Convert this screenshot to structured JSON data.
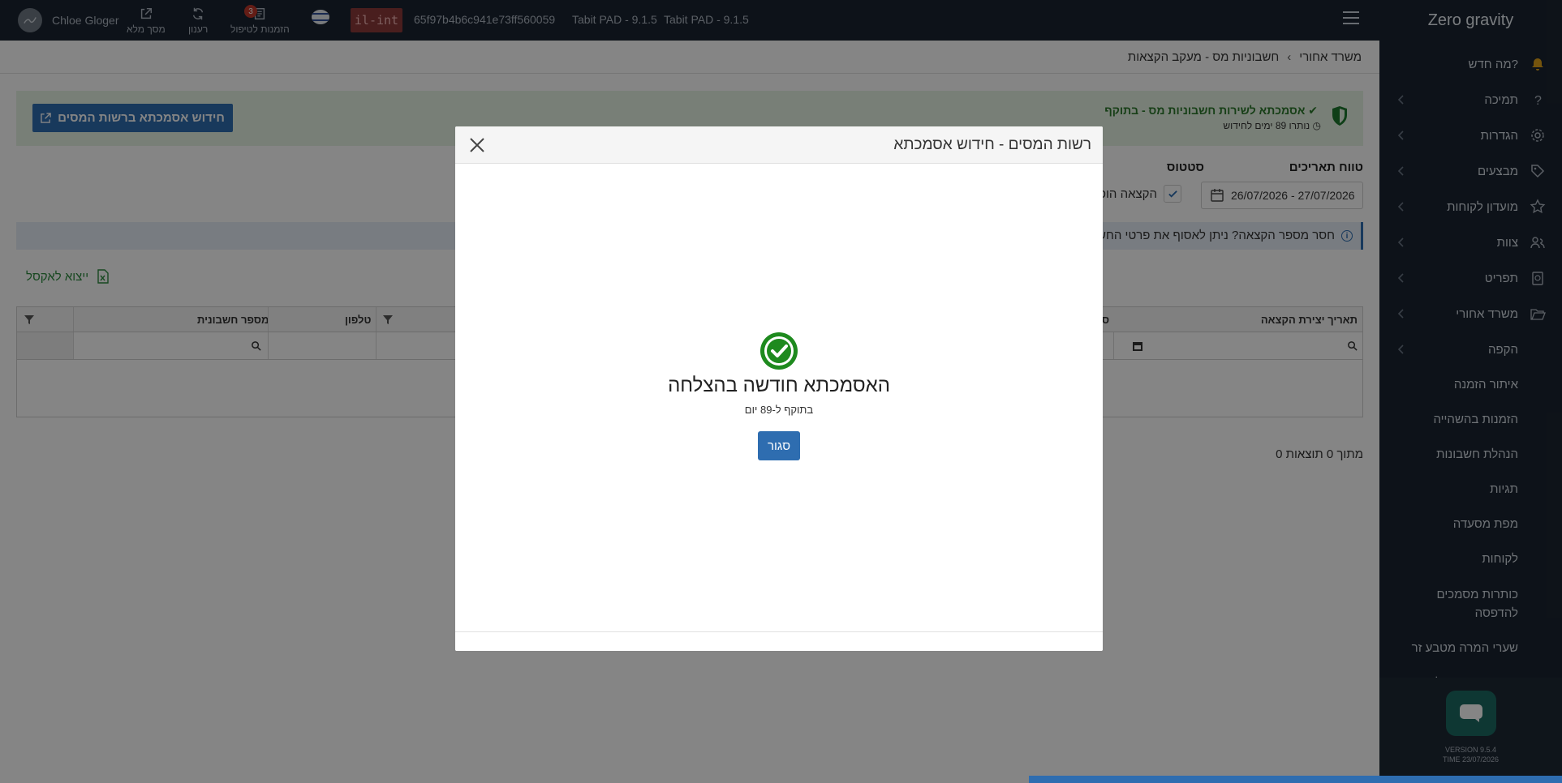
{
  "topbar": {
    "user_name": "Chloe Gloger",
    "fullscreen_label": "מסך מלא",
    "refresh_label": "רענון",
    "orders_label": "הזמנות לטיפול",
    "orders_count": "3",
    "env_badge": "il-int",
    "device_id": "65f97b4b6c941e73ff560059",
    "pad_version_1": "Tabit PAD - 9.1.5",
    "pad_version_2": "Tabit PAD - 9.1.5"
  },
  "sidebar": {
    "brand": "Zero gravity",
    "items": [
      {
        "label": "מה חדש?",
        "icon": "bell-icon"
      },
      {
        "label": "תמיכה",
        "icon": "question-icon"
      },
      {
        "label": "הגדרות",
        "icon": "gear-icon"
      },
      {
        "label": "מבצעים",
        "icon": "tag-icon"
      },
      {
        "label": "מועדון לקוחות",
        "icon": "star-icon"
      },
      {
        "label": "צוות",
        "icon": "team-icon"
      },
      {
        "label": "תפריט",
        "icon": "menu-book-icon"
      },
      {
        "label": "משרד אחורי",
        "icon": "folder-open-icon"
      },
      {
        "label": "הקפה",
        "icon": ""
      }
    ],
    "subitems": [
      "איתור הזמנה",
      "הזמנות בהשהייה",
      "הנהלת חשבונות",
      "תגיות",
      "מפת מסעדה",
      "לקוחות",
      "כותרות מסמכים להדפסה",
      "שערי המרה מטבע זר",
      "הגדרות תצוגת לקוח"
    ],
    "version": "VERSION 9.5.4",
    "time": "TIME 23/07/2026"
  },
  "breadcrumb": {
    "root": "משרד אחורי",
    "current": "חשבוניות מס - מעקב הקצאות"
  },
  "license": {
    "title": "אסמכתא לשירות חשבוניות מס - בתוקף",
    "remaining": "נותרו 89 ימים לחידוש",
    "renew_button": "חידוש אסמכתא ברשות המסים"
  },
  "filters": {
    "date_range_label": "טווח תאריכים",
    "date_range_value": "26/07/2026 - 27/07/2026",
    "status_label": "סטטוס",
    "status_option": "הקצאה הופק"
  },
  "info": {
    "text": "חסר מספר הקצאה? ניתן לאסוף את פרטי החשב"
  },
  "table": {
    "export_label": "ייצוא לאקסל",
    "columns": [
      "תאריך יצירת הקצאה",
      "ס",
      "טלפון",
      "מספר חשבונית"
    ],
    "results_text": "0 מתוך 0 תוצאות"
  },
  "modal": {
    "title": "רשות המסים - חידוש אסמכתא",
    "success_title": "האסמכתא חודשה בהצלחה",
    "success_subtitle": "בתוקף ל-89 יום",
    "close_button": "סגור"
  },
  "colors": {
    "topbar_bg": "#1a2430",
    "primary": "#2e6db0",
    "success": "#1e8a1e",
    "license_bg": "#e7f4e4",
    "chat_button": "#1b6a63"
  }
}
